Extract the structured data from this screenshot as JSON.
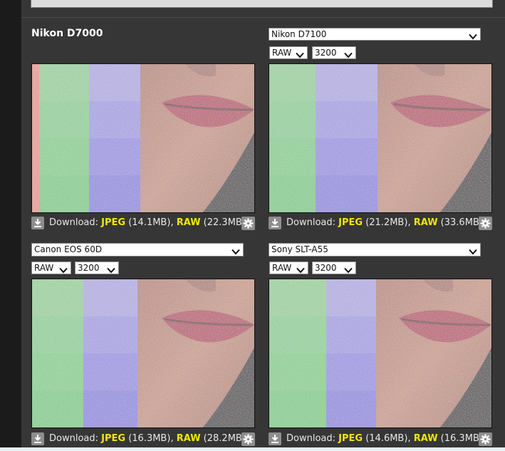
{
  "cells": [
    {
      "camera_title": "Nikon D7000",
      "camera_select": "",
      "format_select": "",
      "iso_select": "",
      "download": {
        "label": "Download:",
        "jpeg_label": "JPEG",
        "jpeg_size": "(14.1MB)",
        "raw_label": "RAW",
        "raw_size": "(22.3MB)"
      }
    },
    {
      "camera_title": "",
      "camera_select": "Nikon D7100",
      "format_select": "RAW",
      "iso_select": "3200",
      "download": {
        "label": "Download:",
        "jpeg_label": "JPEG",
        "jpeg_size": "(21.2MB)",
        "raw_label": "RAW",
        "raw_size": "(33.6MB)"
      }
    },
    {
      "camera_title": "",
      "camera_select": "Canon EOS 60D",
      "format_select": "RAW",
      "iso_select": "3200",
      "download": {
        "label": "Download:",
        "jpeg_label": "JPEG",
        "jpeg_size": "(16.3MB)",
        "raw_label": "RAW",
        "raw_size": "(28.2MB)"
      }
    },
    {
      "camera_title": "",
      "camera_select": "Sony SLT-A55",
      "format_select": "RAW",
      "iso_select": "3200",
      "download": {
        "label": "Download:",
        "jpeg_label": "JPEG",
        "jpeg_size": "(14.6MB)",
        "raw_label": "RAW",
        "raw_size": "(16.3MB)"
      }
    }
  ],
  "icons": {
    "download": "download-icon",
    "settings": "gear-icon",
    "dropdown": "chevron-down-icon"
  },
  "colors": {
    "panel": "#363636",
    "highlight": "#f2e600",
    "skin": "#b98577",
    "lips": "#b23a52"
  }
}
